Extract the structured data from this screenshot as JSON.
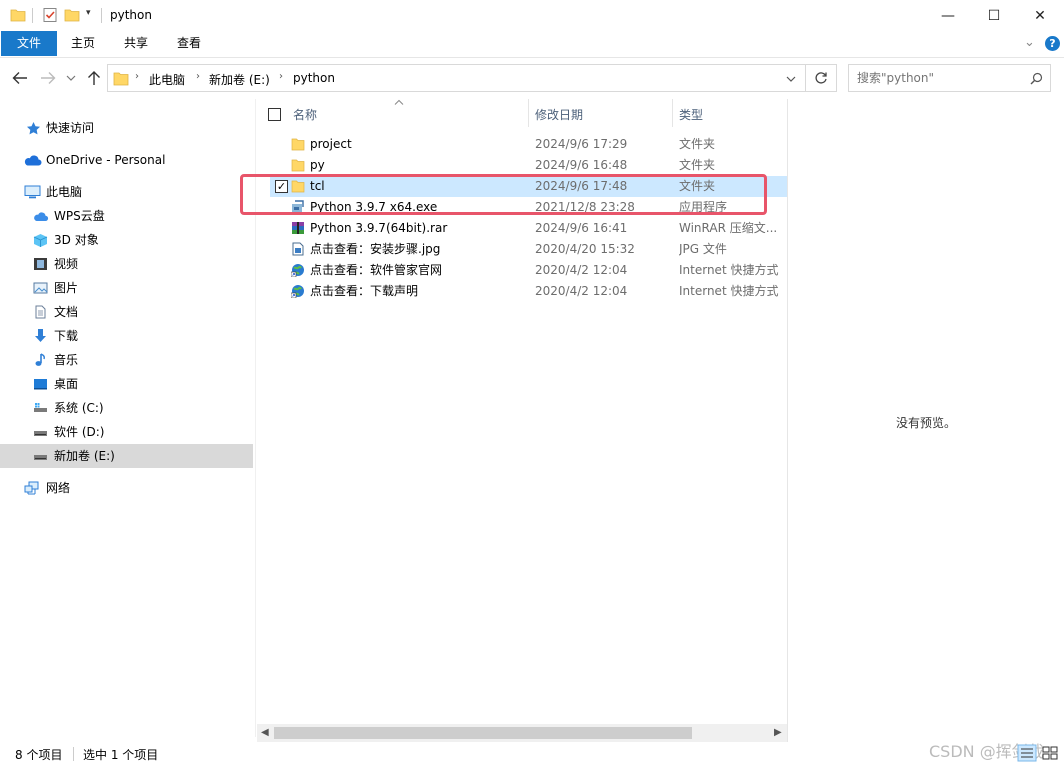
{
  "window": {
    "title": "python",
    "minimize": "—",
    "maximize": "☐",
    "close": "✕"
  },
  "ribbon": {
    "tabs": [
      "文件",
      "主页",
      "共享",
      "查看"
    ],
    "expand": "⌄",
    "help": "?"
  },
  "address": {
    "crumbs": [
      "此电脑",
      "新加卷 (E:)",
      "python"
    ],
    "search_placeholder": "搜索\"python\""
  },
  "nav": {
    "quick_access": "快速访问",
    "onedrive": "OneDrive - Personal",
    "this_pc": "此电脑",
    "items": [
      "WPS云盘",
      "3D 对象",
      "视频",
      "图片",
      "文档",
      "下载",
      "音乐",
      "桌面",
      "系统 (C:)",
      "软件 (D:)",
      "新加卷 (E:)"
    ],
    "network": "网络",
    "selected": "新加卷 (E:)"
  },
  "columns": {
    "name": "名称",
    "date": "修改日期",
    "type": "类型",
    "sort_indicator": "^"
  },
  "files": [
    {
      "name": "project",
      "date": "2024/9/6 17:29",
      "type": "文件夹",
      "icon": "folder-icon"
    },
    {
      "name": "py",
      "date": "2024/9/6 16:48",
      "type": "文件夹",
      "icon": "folder-icon"
    },
    {
      "name": "tcl",
      "date": "2024/9/6 17:48",
      "type": "文件夹",
      "icon": "folder-icon",
      "selected": true
    },
    {
      "name": "Python 3.9.7 x64.exe",
      "date": "2021/12/8 23:28",
      "type": "应用程序",
      "icon": "installer-icon"
    },
    {
      "name": "Python 3.9.7(64bit).rar",
      "date": "2024/9/6 16:41",
      "type": "WinRAR 压缩文...",
      "icon": "winrar-icon"
    },
    {
      "name": "点击查看：安装步骤.jpg",
      "date": "2020/4/20 15:32",
      "type": "JPG 文件",
      "icon": "image-file-icon"
    },
    {
      "name": "点击查看：软件管家官网",
      "date": "2020/4/2 12:04",
      "type": "Internet 快捷方式",
      "icon": "internet-shortcut-icon"
    },
    {
      "name": "点击查看：下载声明",
      "date": "2020/4/2 12:04",
      "type": "Internet 快捷方式",
      "icon": "internet-shortcut-icon"
    }
  ],
  "preview": {
    "empty_text": "没有预览。"
  },
  "status": {
    "count": "8 个项目",
    "selected": "选中 1 个项目"
  },
  "watermark": "CSDN @挥剑截",
  "colors": {
    "accent": "#1979ca",
    "selection": "#cce8ff",
    "highlight_box": "#e8556a",
    "folder": "#ffd766"
  }
}
